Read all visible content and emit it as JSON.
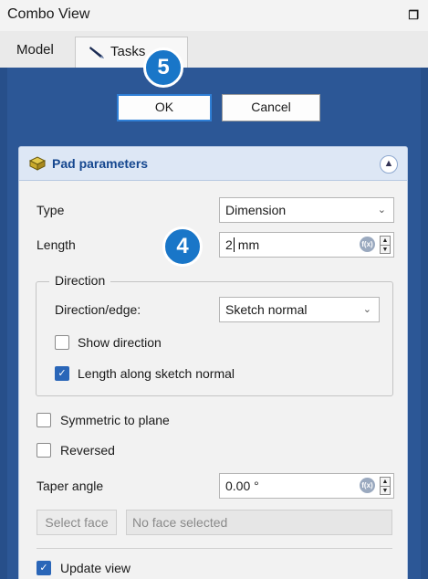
{
  "window": {
    "title": "Combo View",
    "float_icon": "float-window-icon"
  },
  "tabs": [
    {
      "label": "Model",
      "icon": null
    },
    {
      "label": "Tasks",
      "icon": "pencil-icon"
    }
  ],
  "dialog_buttons": {
    "ok_label": "OK",
    "cancel_label": "Cancel"
  },
  "badges": {
    "step5": "5",
    "step4": "4"
  },
  "pad": {
    "title": "Pad parameters",
    "type_label": "Type",
    "type_value": "Dimension",
    "length_label": "Length",
    "length_value": "2",
    "length_unit": "mm",
    "direction_group_title": "Direction",
    "direction_edge_label": "Direction/edge:",
    "direction_edge_value": "Sketch normal",
    "show_direction_label": "Show direction",
    "show_direction_checked": false,
    "length_along_label": "Length along sketch normal",
    "length_along_checked": true,
    "symmetric_label": "Symmetric to plane",
    "symmetric_checked": false,
    "reversed_label": "Reversed",
    "reversed_checked": false,
    "taper_label": "Taper angle",
    "taper_value": "0.00 °",
    "select_face_label": "Select face",
    "face_placeholder": "No face selected",
    "update_view_label": "Update view",
    "update_view_checked": true
  },
  "colors": {
    "accent": "#1976c8",
    "panel_blue": "#274f8a",
    "header_title": "#15478f"
  }
}
